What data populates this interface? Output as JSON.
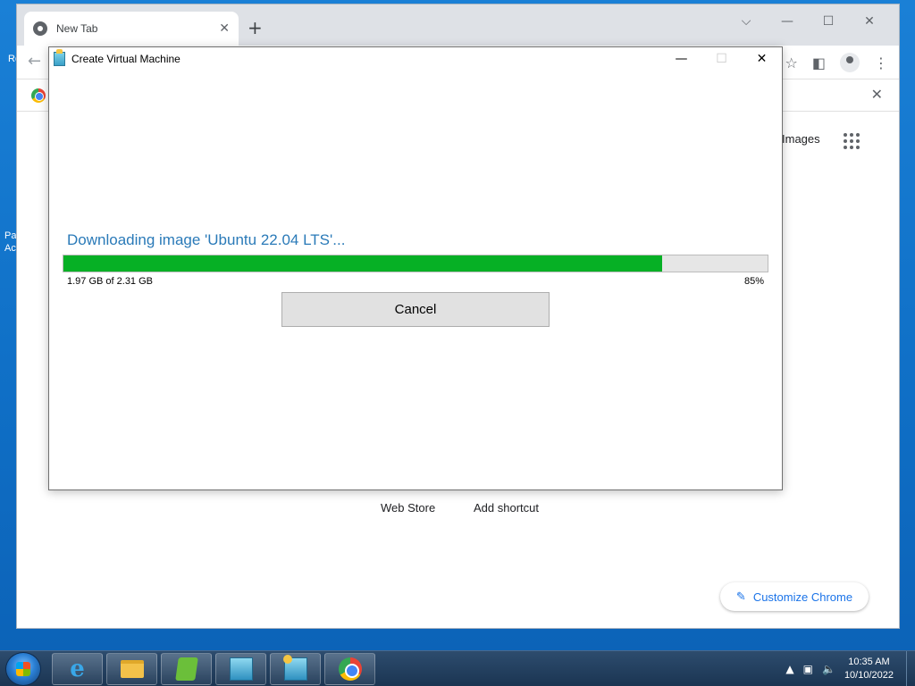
{
  "desktop": {
    "icon_labels": [
      "Re",
      "Pa",
      "Ac"
    ]
  },
  "chrome": {
    "tab_title": "New Tab",
    "new_tab": "+",
    "images_link": "Images",
    "shortcuts": {
      "web_store": "Web Store",
      "add_shortcut": "Add shortcut"
    },
    "customize_label": "Customize Chrome"
  },
  "dialog": {
    "title": "Create Virtual Machine",
    "heading": "Downloading image 'Ubuntu 22.04 LTS'...",
    "progress_text": "1.97 GB of 2.31 GB",
    "progress_percent_text": "85%",
    "progress_fraction": 0.85,
    "cancel_label": "Cancel",
    "progress_color": "#06b025"
  },
  "taskbar": {
    "apps": [
      "start-orb",
      "internet-explorer-icon",
      "file-explorer-icon",
      "green-app-icon",
      "virtual-machine-app-icon",
      "virtual-machine-creator-icon",
      "chrome-icon"
    ],
    "clock_time": "10:35 AM",
    "clock_date": "10/10/2022"
  }
}
